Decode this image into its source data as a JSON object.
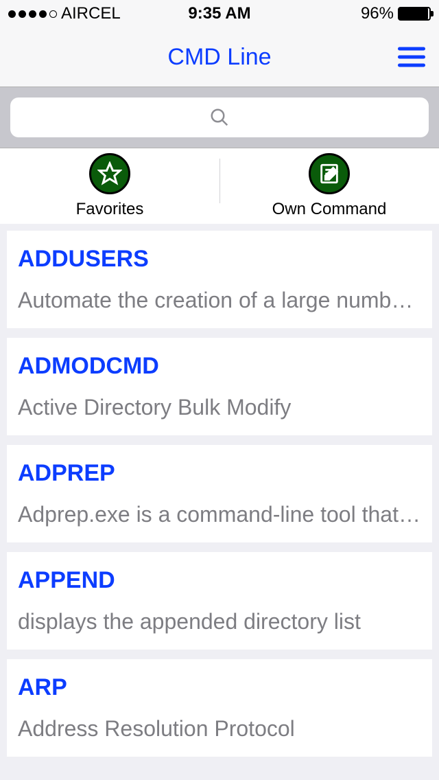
{
  "status": {
    "carrier": "AIRCEL",
    "time": "9:35 AM",
    "battery_pct": "96%"
  },
  "nav": {
    "title": "CMD Line"
  },
  "search": {
    "placeholder": ""
  },
  "tabs": {
    "favorites": "Favorites",
    "own": "Own Command"
  },
  "commands": [
    {
      "name": "ADDUSERS",
      "desc": "Automate the creation of a large number of users"
    },
    {
      "name": "ADMODCMD",
      "desc": "Active Directory Bulk Modify"
    },
    {
      "name": "ADPREP",
      "desc": "Adprep.exe is a command-line tool that prepares a forest and domain"
    },
    {
      "name": "APPEND",
      "desc": "displays the appended directory list"
    },
    {
      "name": "ARP",
      "desc": "Address Resolution Protocol"
    }
  ]
}
